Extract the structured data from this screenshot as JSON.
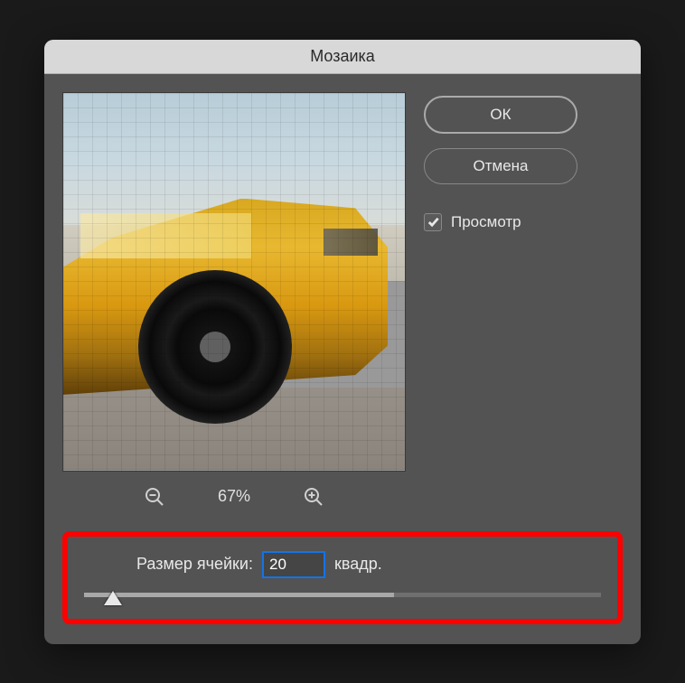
{
  "dialog": {
    "title": "Мозаика"
  },
  "preview": {
    "zoom_level": "67%"
  },
  "buttons": {
    "ok": "ОК",
    "cancel": "Отмена"
  },
  "checkbox": {
    "preview_label": "Просмотр",
    "preview_checked": true
  },
  "settings": {
    "cell_size_label": "Размер ячейки:",
    "cell_size_value": "20",
    "cell_size_unit": "квадр."
  }
}
